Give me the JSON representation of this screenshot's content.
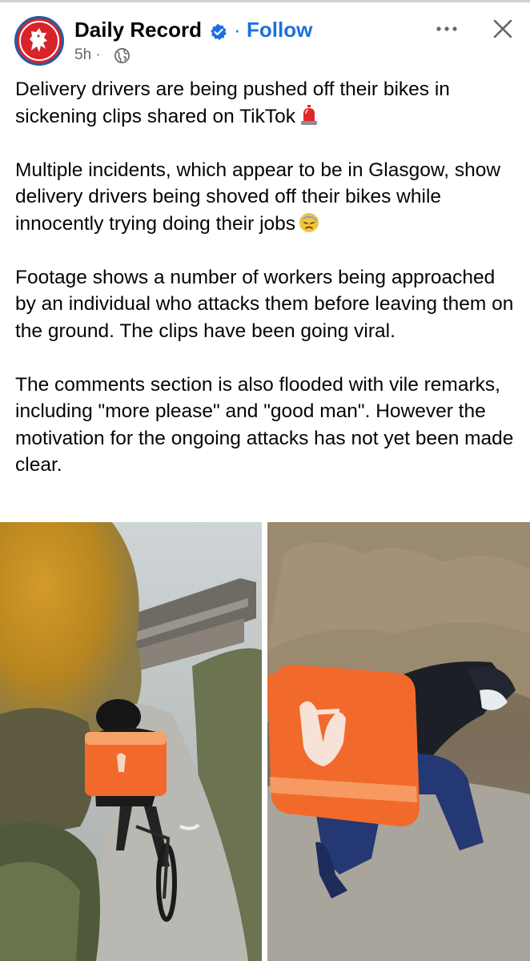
{
  "header": {
    "page_name": "Daily Record",
    "separator": "·",
    "follow_label": "Follow",
    "timestamp": "5h ·",
    "avatar_icon": "daily-record-lion-logo",
    "verified_icon": "verified-badge-icon",
    "privacy_icon": "globe-icon",
    "more_icon": "more-horizontal-icon",
    "close_icon": "close-icon",
    "accent_color": "#1d6fe0"
  },
  "post": {
    "paragraphs": [
      "Delivery drivers are being pushed off their bikes in sickening clips shared on TikTok",
      "Multiple incidents, which appear to be in Glasgow, show delivery drivers being shoved off their bikes while innocently trying doing their jobs",
      "Footage shows a number of workers being approached by an individual who attacks them before leaving them on the ground. The clips have been going viral.",
      "The comments section is also flooded with vile remarks, including \"more please\" and \"good man\". However the motivation for the ongoing attacks has not yet been made clear."
    ],
    "emojis": [
      "police-light-emoji",
      "sad-sweat-emoji"
    ]
  },
  "media": {
    "images": [
      {
        "name": "rider-on-path-photo",
        "description_icon": "video-still"
      },
      {
        "name": "rider-falling-photo",
        "description_icon": "video-still"
      }
    ],
    "brand_color": "#f26a2b"
  }
}
